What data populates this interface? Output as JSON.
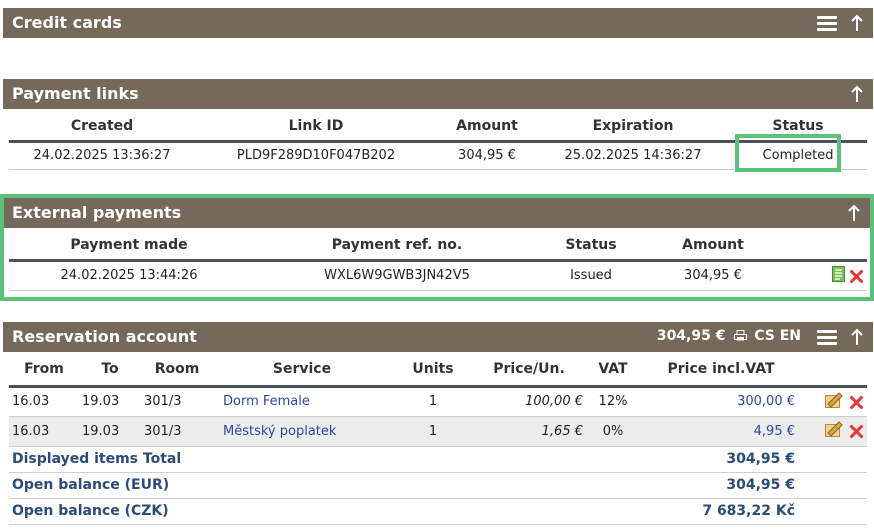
{
  "credit_cards": {
    "title": "Credit cards"
  },
  "payment_links": {
    "title": "Payment links",
    "headers": [
      "Created",
      "Link ID",
      "Amount",
      "Expiration",
      "Status"
    ],
    "rows": [
      {
        "created": "24.02.2025 13:36:27",
        "link_id": "PLD9F289D10F047B202",
        "amount": "304,95 €",
        "expiration": "25.02.2025 14:36:27",
        "status": "Completed"
      }
    ]
  },
  "external_payments": {
    "title": "External payments",
    "headers": [
      "Payment made",
      "Payment ref. no.",
      "Status",
      "Amount"
    ],
    "rows": [
      {
        "made": "24.02.2025 13:44:26",
        "ref": "WXL6W9GWB3JN42V5",
        "status": "Issued",
        "amount": "304,95 €"
      }
    ]
  },
  "reservation_account": {
    "title": "Reservation account",
    "balance": "304,95 €",
    "languages": "CS EN",
    "headers": [
      "From",
      "To",
      "Room",
      "Service",
      "Units",
      "Price/Un.",
      "VAT",
      "Price incl.VAT"
    ],
    "rows": [
      {
        "from": "16.03",
        "to": "19.03",
        "room": "301/3",
        "service": "Dorm Female",
        "units": "1",
        "price_unit": "100,00 €",
        "vat": "12%",
        "price_vat": "300,00 €"
      },
      {
        "from": "16.03",
        "to": "19.03",
        "room": "301/3",
        "service": "Městský poplatek",
        "units": "1",
        "price_unit": "1,65 €",
        "vat": "0%",
        "price_vat": "4,95 €"
      }
    ],
    "totals": {
      "displayed_label": "Displayed items Total",
      "displayed_value": "304,95 €",
      "open_eur_label": "Open balance (EUR)",
      "open_eur_value": "304,95 €",
      "open_czk_label": "Open balance (CZK)",
      "open_czk_value": "7 683,22 Kč"
    }
  },
  "colors": {
    "header_bg": "#74695a",
    "highlight": "#5bc27a",
    "delete": "#e03b3b",
    "link": "#2c47a8",
    "balance_red": "#c0171c"
  },
  "icons": [
    "hamburger-menu-icon",
    "arrow-up-icon",
    "document-icon",
    "delete-icon",
    "edit-icon",
    "printer-icon"
  ]
}
